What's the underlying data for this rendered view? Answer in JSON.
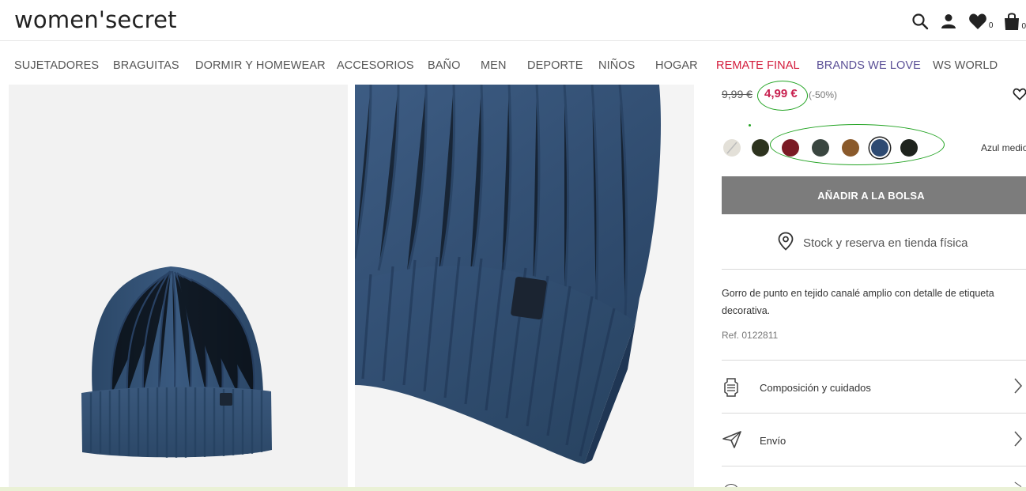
{
  "header": {
    "logo": "women'secret",
    "icons": [
      "search-icon",
      "user-icon",
      "heart-icon",
      "bag-icon"
    ],
    "wishlist_count": "0",
    "bag_count": "0"
  },
  "nav": {
    "items": [
      {
        "label": "SUJETADORES"
      },
      {
        "label": "BRAGUITAS"
      },
      {
        "label": "DORMIR Y HOMEWEAR"
      },
      {
        "label": "ACCESORIOS"
      },
      {
        "label": "BAÑO"
      },
      {
        "label": "MEN"
      },
      {
        "label": "DEPORTE"
      },
      {
        "label": "NIÑOS"
      },
      {
        "label": "HOGAR"
      },
      {
        "label": "REMATE FINAL",
        "color": "#d31a3a"
      },
      {
        "label": "BRANDS WE LOVE",
        "color": "#5a4f96"
      },
      {
        "label": "WS WORLD"
      }
    ]
  },
  "product": {
    "old_price": "9,99 €",
    "new_price": "4,99 €",
    "discount": "(-50%)",
    "swatches": [
      {
        "color": "#e3e0d8",
        "unavailable": true
      },
      {
        "color": "#2d331e"
      },
      {
        "color": "#7a1a24"
      },
      {
        "color": "#3a4640"
      },
      {
        "color": "#8a5a2b"
      },
      {
        "color": "#2e4a72",
        "selected": true
      },
      {
        "color": "#1e231d"
      }
    ],
    "selected_color_name": "Azul medio",
    "add_to_bag": "AÑADIR A LA BOLSA",
    "stock_label": "Stock y reserva en tienda física",
    "description": "Gorro de punto en tejido canalé amplio con detalle de etiqueta decorativa.",
    "reference": "Ref. 0122811",
    "accordion": [
      {
        "label": "Composición y cuidados",
        "icon": "care-label-icon"
      },
      {
        "label": "Envío",
        "icon": "send-icon"
      }
    ]
  },
  "colors": {
    "sale_price": "#c8204f",
    "annotation": "#22a322",
    "button": "#7c7c7c"
  }
}
